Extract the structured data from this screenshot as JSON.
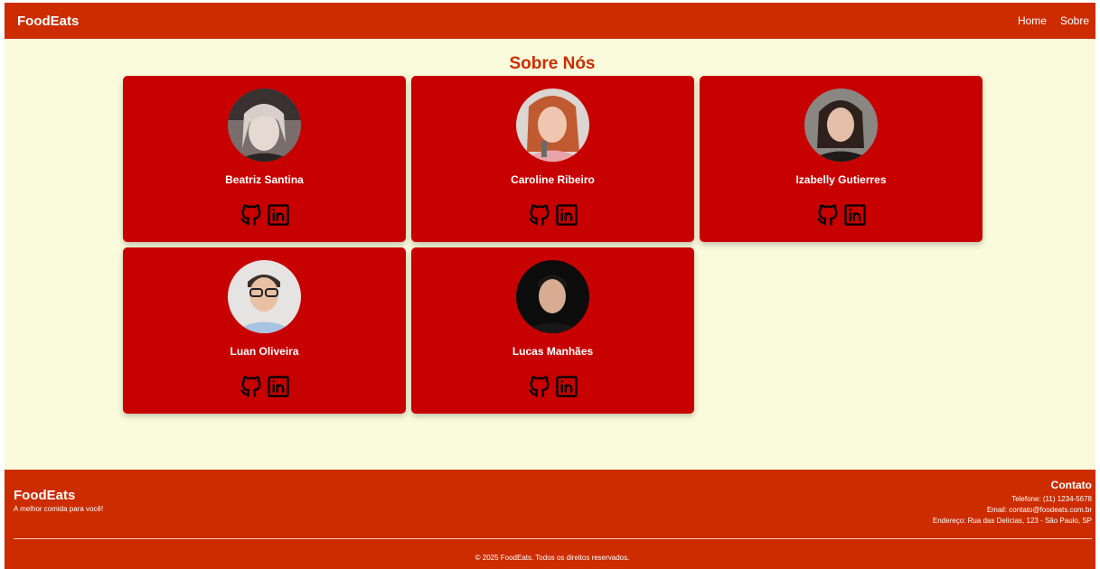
{
  "nav": {
    "brand": "FoodEats",
    "links": [
      "Home",
      "Sobre"
    ]
  },
  "page": {
    "title": "Sobre Nós"
  },
  "members": [
    {
      "name": "Beatriz Santina",
      "icons": [
        "github-icon",
        "linkedin-icon"
      ]
    },
    {
      "name": "Caroline Ribeiro",
      "icons": [
        "github-icon",
        "linkedin-icon"
      ]
    },
    {
      "name": "Izabelly Gutierres",
      "icons": [
        "github-icon",
        "linkedin-icon"
      ]
    },
    {
      "name": "Luan Oliveira",
      "icons": [
        "github-icon",
        "linkedin-icon"
      ]
    },
    {
      "name": "Lucas Manhães",
      "icons": [
        "github-icon",
        "linkedin-icon"
      ]
    }
  ],
  "footer": {
    "brand": "FoodEats",
    "tagline": "A melhor comida para você!",
    "contact": {
      "title": "Contato",
      "phone": "Telefone: (11) 1234-5678",
      "email": "Email: contato@foodeats.com.br",
      "address": "Endereço: Rua das Delícias, 123 - São Paulo, SP"
    },
    "copyright": "© 2025 FoodEats. Todos os direitos reservados."
  },
  "colors": {
    "accent": "#cc2c00",
    "card": "#c70000",
    "background": "#fafadc",
    "text_on_accent": "#ffffff"
  }
}
